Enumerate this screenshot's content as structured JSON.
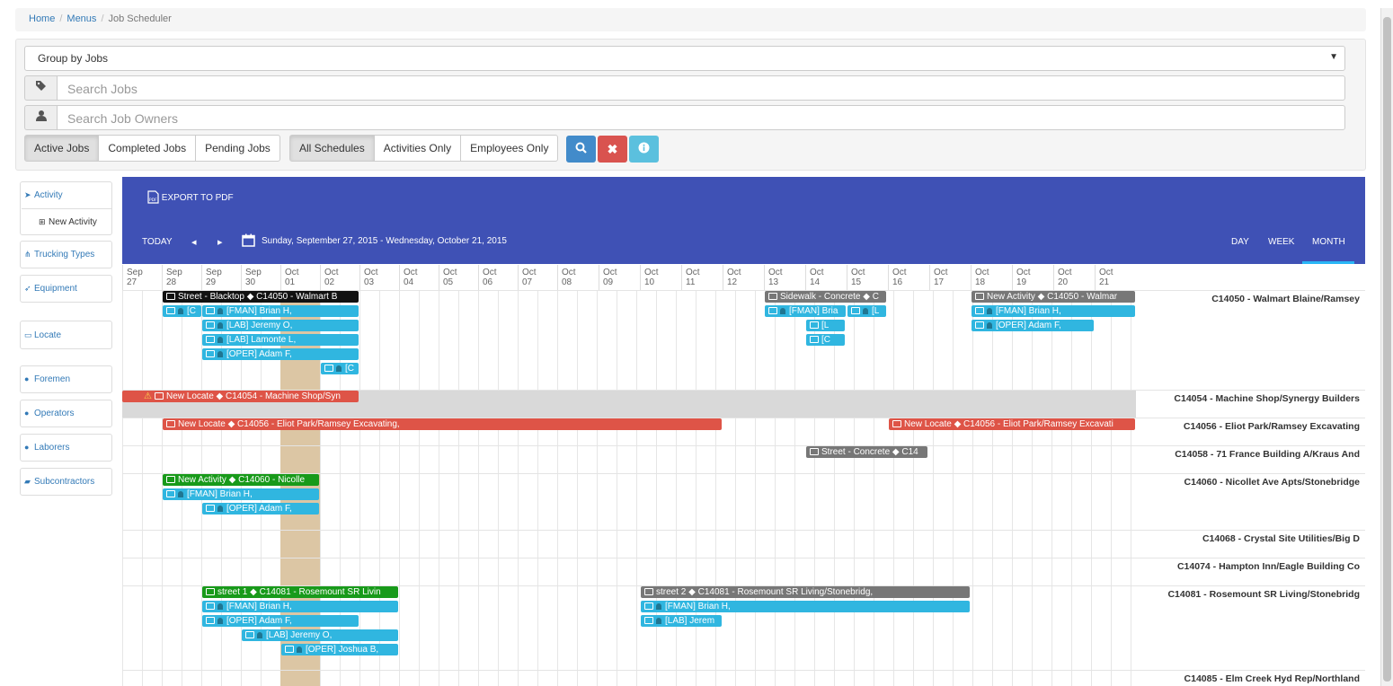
{
  "breadcrumb": {
    "home": "Home",
    "menus": "Menus",
    "current": "Job Scheduler"
  },
  "filters": {
    "group_by": "Group by Jobs",
    "search_jobs_placeholder": "Search Jobs",
    "search_owners_placeholder": "Search Job Owners",
    "job_status": [
      "Active Jobs",
      "Completed Jobs",
      "Pending Jobs"
    ],
    "job_status_active": "Active Jobs",
    "schedule_types": [
      "All Schedules",
      "Activities Only",
      "Employees Only"
    ],
    "schedule_active": "All Schedules",
    "colors": {
      "search": "#428bca",
      "clear": "#d9534f",
      "info": "#5bc0de"
    }
  },
  "sidebar": {
    "activity": "Activity",
    "new_activity": "New Activity",
    "trucking": "Trucking Types",
    "equipment": "Equipment",
    "locate": "Locate",
    "foremen": "Foremen",
    "operators": "Operators",
    "laborers": "Laborers",
    "subcontractors": "Subcontractors"
  },
  "scheduler": {
    "export": "EXPORT TO PDF",
    "today": "TODAY",
    "range": "Sunday, September 27, 2015 - Wednesday, October 21, 2015",
    "views": [
      "DAY",
      "WEEK",
      "MONTH"
    ],
    "active_view": "MONTH",
    "header_color": "#3f51b5",
    "days": [
      [
        "Sep",
        "27"
      ],
      [
        "Sep",
        "28"
      ],
      [
        "Sep",
        "29"
      ],
      [
        "Sep",
        "30"
      ],
      [
        "Oct",
        "01"
      ],
      [
        "Oct",
        "02"
      ],
      [
        "Oct",
        "03"
      ],
      [
        "Oct",
        "04"
      ],
      [
        "Oct",
        "05"
      ],
      [
        "Oct",
        "06"
      ],
      [
        "Oct",
        "07"
      ],
      [
        "Oct",
        "08"
      ],
      [
        "Oct",
        "09"
      ],
      [
        "Oct",
        "10"
      ],
      [
        "Oct",
        "11"
      ],
      [
        "Oct",
        "12"
      ],
      [
        "Oct",
        "13"
      ],
      [
        "Oct",
        "14"
      ],
      [
        "Oct",
        "15"
      ],
      [
        "Oct",
        "16"
      ],
      [
        "Oct",
        "17"
      ],
      [
        "Oct",
        "18"
      ],
      [
        "Oct",
        "19"
      ],
      [
        "Oct",
        "20"
      ],
      [
        "Oct",
        "21"
      ]
    ],
    "rows": [
      "C14050 - Walmart Blaine/Ramsey",
      "C14054 - Machine Shop/Synergy Builders",
      "C14056 - Eliot Park/Ramsey Excavating",
      "C14058 - 71 France Building A/Kraus And",
      "C14060 - Nicollet Ave Apts/Stonebridge",
      "C14068 - Crystal Site Utilities/Big D",
      "C14074 - Hampton Inn/Eagle Building Co",
      "C14081 - Rosemount SR Living/Stonebridg",
      "C14085 - Elm Creek Hyd Rep/Northland"
    ],
    "events": {
      "e1": "Street - Blacktop ◆ C14050 - Walmart B",
      "e2": "[FMAN] Brian H,",
      "e3": "[LAB] Jeremy O,",
      "e4": "[LAB] Lamonte L,",
      "e5": "[OPER] Adam F,",
      "e6": "Sidewalk - Concrete ◆ C",
      "e7": "[FMAN] Bria",
      "e8": "New Activity ◆ C14050 - Walmar",
      "e9": "[FMAN] Brian H,",
      "e10": "[OPER] Adam F,",
      "e11": "New Locate ◆ C14054 - Machine Shop/Syn",
      "e12": "New Locate ◆ C14056 - Eliot Park/Ramsey Excavating,",
      "e13": "New Locate ◆ C14056 - Eliot Park/Ramsey Excavati",
      "e14": "Street - Concrete ◆ C14",
      "e15": "New Activity ◆ C14060 - Nicolle",
      "e16": "[FMAN] Brian H,",
      "e17": "[OPER] Adam F,",
      "e18": "street 1 ◆ C14081 - Rosemount SR Livin",
      "e19": "[FMAN] Brian H,",
      "e20": "[OPER] Adam F,",
      "e21": "[LAB] Jeremy O,",
      "e22": "[OPER] Joshua B,",
      "e23": "street 2 ◆ C14081 - Rosemount SR Living/Stonebridg,",
      "e24": "[FMAN] Brian H,",
      "e25": "[LAB] Jerem",
      "e26": "[L",
      "e27": "[C",
      "e28": "[L",
      "e29": "[C",
      "e30": "[C"
    }
  }
}
